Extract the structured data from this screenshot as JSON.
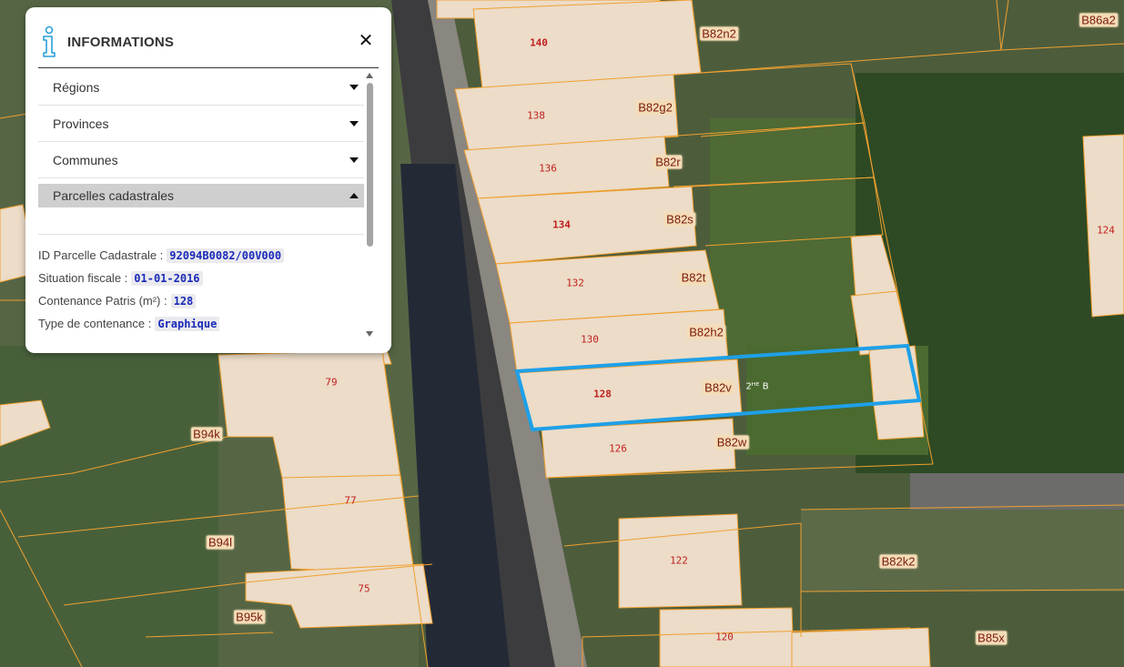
{
  "panel": {
    "title": "INFORMATIONS",
    "close_label": "✕",
    "icon": "info-icon",
    "accordion": [
      {
        "label": "Régions",
        "state": "collapsed"
      },
      {
        "label": "Provinces",
        "state": "collapsed"
      },
      {
        "label": "Communes",
        "state": "collapsed"
      },
      {
        "label": "Parcelles cadastrales",
        "state": "expanded"
      }
    ],
    "fields": [
      {
        "label": "ID Parcelle Cadastrale :",
        "value": "92094B0082/00V000"
      },
      {
        "label": "Situation fiscale :",
        "value": "01-01-2016"
      },
      {
        "label": "Contenance Patris (m²) :",
        "value": "128"
      },
      {
        "label": "Type de contenance :",
        "value": "Graphique"
      }
    ]
  },
  "map": {
    "colors": {
      "building": "#ecdcc8",
      "parcel_line": "#f0a030",
      "selection": "#1ea0e8",
      "house_number": "#c0201e"
    },
    "house_numbers": {
      "n140": "140",
      "n138": "138",
      "n136": "136",
      "n134": "134",
      "n132": "132",
      "n130": "130",
      "n128": "128",
      "n126": "126",
      "n124": "124",
      "n122": "122",
      "n120": "120",
      "n79": "79",
      "n77": "77",
      "n75": "75"
    },
    "parcel_labels": {
      "B82n2": "B82n2",
      "B86a2": "B86a2",
      "B82g2": "B82g2",
      "B82r": "B82r",
      "B82s": "B82s",
      "B82t": "B82t",
      "B82h2": "B82h2",
      "B82v": "B82v",
      "B82w": "B82w",
      "B94k": "B94k",
      "B94l": "B94l",
      "B95k": "B95k",
      "B82k2": "B82k2",
      "B85x": "B85x"
    },
    "small_text": "2ᴴᴱ B"
  }
}
